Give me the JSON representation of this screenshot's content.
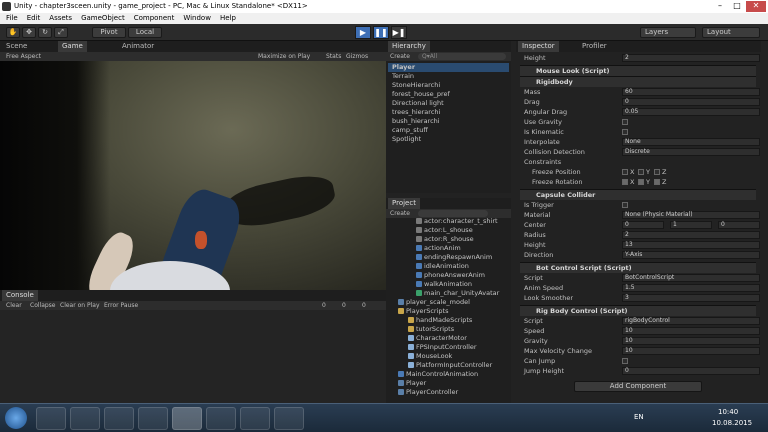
{
  "window": {
    "title": "Unity - chapter3sceen.unity - game_project - PC, Mac & Linux Standalone* <DX11>",
    "btn_min": "–",
    "btn_max": "□",
    "btn_close": "✕"
  },
  "menu": [
    "File",
    "Edit",
    "Assets",
    "GameObject",
    "Component",
    "Window",
    "Help"
  ],
  "toolbar": {
    "pivot": "Pivot",
    "local": "Local",
    "layers": "Layers",
    "layout": "Layout",
    "play": "▶",
    "pause": "❚❚",
    "step": "▶❚"
  },
  "scene_panel": {
    "tab_scene": "Scene",
    "tab_game": "Game",
    "tab_animator": "Animator",
    "aspect": "Free Aspect",
    "maximize": "Maximize on Play",
    "stats": "Stats",
    "gizmos": "Gizmos"
  },
  "hierarchy": {
    "tab": "Hierarchy",
    "create": "Create",
    "search_placeholder": "Q▾All",
    "items": [
      "Player",
      "Terrain",
      "StoneHierarchi",
      "forest_house_pref",
      "Directional light",
      "trees_hierarchi",
      "bush_hierarchi",
      "camp_stuff",
      "Spotlight"
    ]
  },
  "project": {
    "tab": "Project",
    "create": "Create",
    "items": [
      "actor:character_t_shirt",
      "actor:L_shouse",
      "actor:R_shouse",
      "actionAnim",
      "endingRespawnAnim",
      "idleAnimation",
      "phoneAnswerAnim",
      "walkAnimation",
      "main_char_UnityAvatar",
      "player_scale_model",
      "PlayerScripts",
      "handMadeScripts",
      "tutorScripts",
      "CharacterMotor",
      "FPSInputController",
      "MouseLook",
      "PlatformInputController",
      "MainControlAnimation",
      "Player",
      "PlayerController"
    ]
  },
  "console": {
    "tab": "Console",
    "clear": "Clear",
    "collapse": "Collapse",
    "clear_on_play": "Clear on Play",
    "error_pause": "Error Pause",
    "count_logs": "0",
    "count_warn": "0",
    "count_err": "0"
  },
  "inspector": {
    "tab": "Inspector",
    "tab2": "Profiler",
    "height_label": "Height",
    "height_value": "2",
    "mouse_look": "Mouse Look (Script)",
    "rigidbody": "Rigidbody",
    "rb_rows": [
      [
        "Mass",
        "60"
      ],
      [
        "Drag",
        "0"
      ],
      [
        "Angular Drag",
        "0.05"
      ],
      [
        "Use Gravity",
        ""
      ],
      [
        "Is Kinematic",
        ""
      ],
      [
        "Interpolate",
        "None"
      ],
      [
        "Collision Detection",
        "Discrete"
      ]
    ],
    "constraints": "Constraints",
    "freeze_pos": "Freeze Position",
    "freeze_rot": "Freeze Rotation",
    "x": "X",
    "y": "Y",
    "z": "Z",
    "capsule": "Capsule Collider",
    "cc_rows": [
      [
        "Is Trigger",
        ""
      ],
      [
        "Material",
        "None (Physic Material)"
      ],
      [
        "Center",
        ""
      ],
      [
        "Radius",
        "2"
      ],
      [
        "Height",
        "13"
      ],
      [
        "Direction",
        "Y-Axis"
      ]
    ],
    "center_x": "0",
    "center_y": "1",
    "center_z": "0",
    "bot": "Bot Control Script (Script)",
    "bot_rows": [
      [
        "Script",
        "BotControlScript"
      ],
      [
        "Anim Speed",
        "1.5"
      ],
      [
        "Look Smoother",
        "3"
      ]
    ],
    "rig": "Rig Body Control (Script)",
    "rig_rows": [
      [
        "Script",
        "rigBodyControl"
      ],
      [
        "Speed",
        "10"
      ],
      [
        "Gravity",
        "10"
      ],
      [
        "Max Velocity Change",
        "10"
      ],
      [
        "Can Jump",
        ""
      ],
      [
        "Jump Height",
        "0"
      ]
    ],
    "add_component": "Add Component"
  },
  "taskbar": {
    "lang": "EN",
    "time": "10:40",
    "date": "10.08.2015"
  }
}
